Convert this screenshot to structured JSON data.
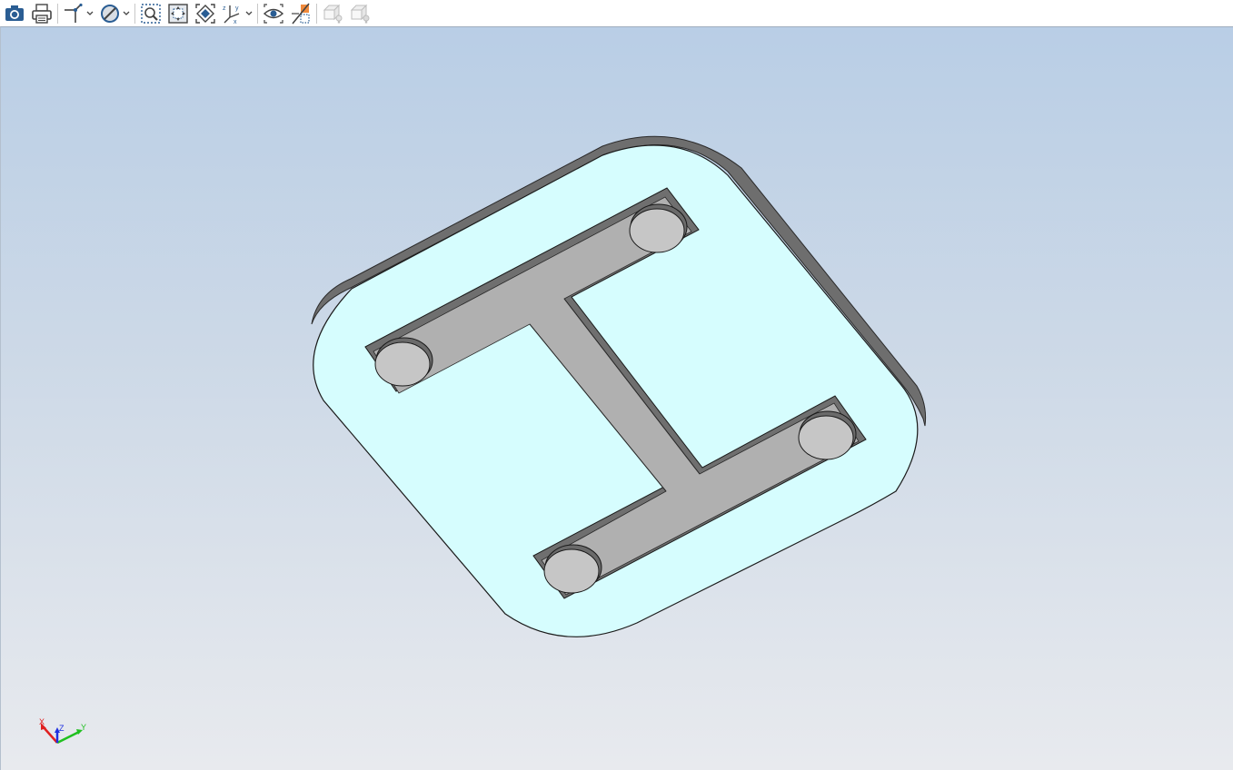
{
  "toolbar": {
    "buttons": [
      {
        "name": "screenshot-icon",
        "disabled": false,
        "dropdown": false
      },
      {
        "name": "print-icon",
        "disabled": false,
        "dropdown": false
      },
      {
        "name": "sketch-axes-icon",
        "disabled": false,
        "dropdown": true
      },
      {
        "name": "display-style-icon",
        "disabled": false,
        "dropdown": true
      },
      {
        "name": "zoom-window-icon",
        "disabled": false,
        "dropdown": false
      },
      {
        "name": "fit-all-icon",
        "disabled": false,
        "dropdown": false
      },
      {
        "name": "view-orientation-icon",
        "disabled": false,
        "dropdown": false
      },
      {
        "name": "coordinate-system-icon",
        "disabled": false,
        "dropdown": true
      },
      {
        "name": "visibility-eye-icon",
        "disabled": false,
        "dropdown": false
      },
      {
        "name": "section-view-icon",
        "disabled": false,
        "dropdown": false
      },
      {
        "name": "box-light-icon",
        "disabled": true,
        "dropdown": false
      },
      {
        "name": "box-light-alt-icon",
        "disabled": true,
        "dropdown": false
      }
    ]
  },
  "viewport": {
    "background_top": "#b9cee6",
    "background_bottom": "#e8eaee",
    "part_face_color": "#d6fdfe",
    "groove_color": "#b0b0b0",
    "groove_wall_color": "#7a7a7a"
  },
  "triad": {
    "x_label": "X",
    "y_label": "Y",
    "z_label": "Z",
    "x_color": "#e02020",
    "y_color": "#20c020",
    "z_color": "#2030e0"
  }
}
